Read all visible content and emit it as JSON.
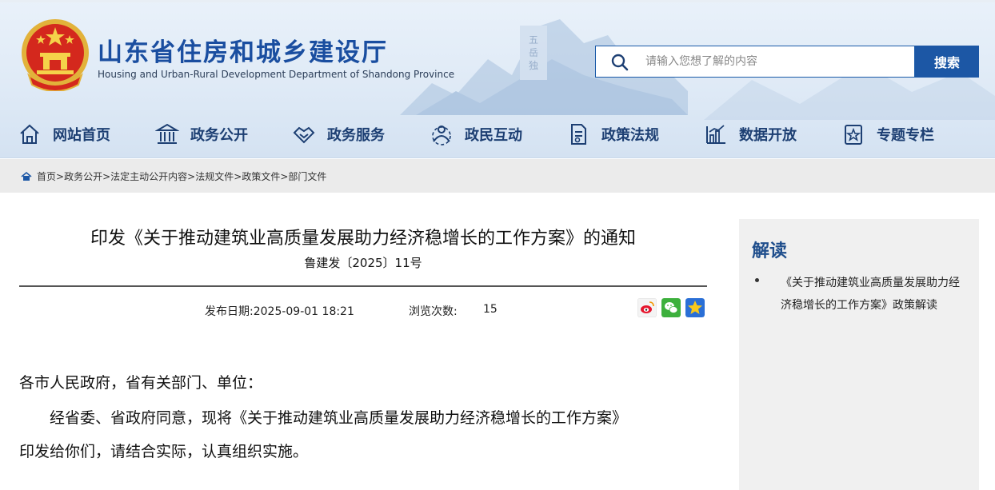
{
  "header": {
    "title": "山东省住房和城乡建设厅",
    "subtitle": "Housing and Urban-Rural Development Department of Shandong Province",
    "emblem_icon": "national-emblem-icon",
    "search": {
      "placeholder": "请输入您想了解的内容",
      "value": "",
      "button_label": "搜索"
    },
    "colors": {
      "brand": "#1a4ea0",
      "nav_text": "#1d3f73",
      "search_button": "#1c57a5"
    }
  },
  "nav": {
    "items": [
      {
        "label": "网站首页",
        "icon": "home-icon"
      },
      {
        "label": "政务公开",
        "icon": "building-icon"
      },
      {
        "label": "政务服务",
        "icon": "handshake-icon"
      },
      {
        "label": "政民互动",
        "icon": "interaction-icon"
      },
      {
        "label": "政策法规",
        "icon": "document-icon"
      },
      {
        "label": "数据开放",
        "icon": "bar-chart-icon"
      },
      {
        "label": "专题专栏",
        "icon": "topic-icon"
      }
    ]
  },
  "breadcrumb": {
    "icon": "home-icon",
    "items": [
      "首页",
      "政务公开",
      "法定主动公开内容",
      "法规文件",
      "政策文件",
      "部门文件"
    ],
    "separator": ">"
  },
  "article": {
    "title": "印发《关于推动建筑业高质量发展助力经济稳增长的工作方案》的通知",
    "doc_number": "鲁建发〔2025〕11号",
    "publish_label": "发布日期:",
    "publish_date": "2025-09-01 18:21",
    "views_label": "浏览次数:",
    "views_count": "15",
    "share_icons": [
      "weibo-icon",
      "wechat-icon",
      "qzone-icon"
    ],
    "paragraphs": [
      "各市人民政府，省有关部门、单位：",
      "经省委、省政府同意，现将《关于推动建筑业高质量发展助力经济稳增长的工作方案》",
      "印发给你们，请结合实际，认真组织实施。"
    ]
  },
  "sidebar": {
    "title": "解读",
    "items": [
      "《关于推动建筑业高质量发展助力经济稳增长的工作方案》政策解读"
    ]
  }
}
